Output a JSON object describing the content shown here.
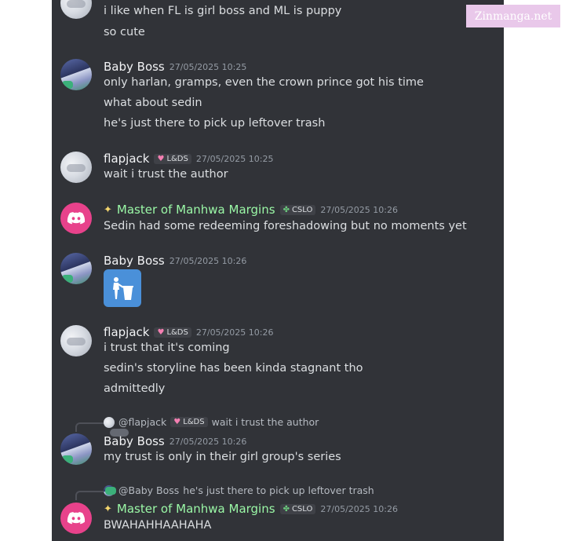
{
  "watermark": "Zinmanga.net",
  "messages": [
    {
      "lines": [
        "i like when FL is girl boss and ML is puppy",
        "so cute"
      ]
    },
    {
      "author": "Baby Boss",
      "time": "27/05/2025 10:25",
      "lines": [
        "only harlan, gramps, even the crown prince got his time",
        "what about sedin",
        "he's just there to pick up leftover trash"
      ]
    },
    {
      "author": "flapjack",
      "tag": "L&DS",
      "time": "27/05/2025 10:25",
      "lines": [
        "wait i trust the author"
      ]
    },
    {
      "author": "Master of Manhwa Margins",
      "tag": "CSLO",
      "time": "27/05/2025 10:26",
      "lines": [
        "Sedin had some redeeming foreshadowing but no moments yet"
      ]
    },
    {
      "author": "Baby Boss",
      "time": "27/05/2025 10:26",
      "emoji": "put-litter-in-its-place-icon"
    },
    {
      "author": "flapjack",
      "tag": "L&DS",
      "time": "27/05/2025 10:26",
      "lines": [
        "i trust that it's coming",
        "sedin's storyline has been kinda stagnant tho",
        "admittedly"
      ]
    },
    {
      "reply": {
        "author": "@flapjack",
        "tag": "L&DS",
        "text": "wait i trust the author"
      },
      "author": "Baby Boss",
      "time": "27/05/2025 10:26",
      "lines": [
        "my trust is only in their girl group's series"
      ]
    },
    {
      "reply": {
        "author": "@Baby Boss",
        "text": "he's just there to pick up leftover trash"
      },
      "author": "Master of Manhwa Margins",
      "tag": "CSLO",
      "time": "27/05/2025 10:26",
      "lines": [
        "BWAHAHHAAHAHA"
      ]
    }
  ],
  "colors": {
    "background": "#313338",
    "text": "#dbdee1",
    "timestamp": "#949ba4",
    "master_name": "#9af7a6",
    "discord_avatar": "#e8428b",
    "emoji_tile": "#4a90d9"
  }
}
